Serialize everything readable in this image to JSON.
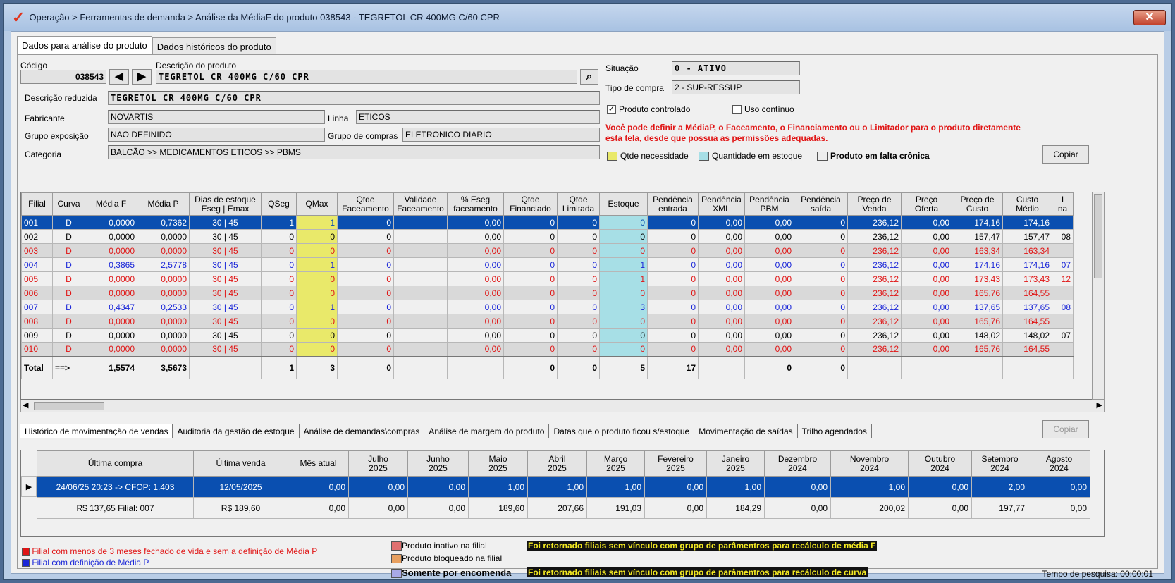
{
  "window": {
    "title": "Operação > Ferramentas de demanda > Análise da MédiaF do produto 038543 - TEGRETOL CR 400MG C/60 CPR",
    "close": "✕"
  },
  "tabs": [
    "Dados para análise do produto",
    "Dados históricos do produto"
  ],
  "form": {
    "codigo_label": "Código",
    "codigo": "038543",
    "descricao_label": "Descrição do produto",
    "descricao": "TEGRETOL CR 400MG C/60 CPR",
    "desc_reduzida_label": "Descrição reduzida",
    "desc_reduzida": "TEGRETOL CR 400MG C/60 CPR",
    "fabricante_label": "Fabricante",
    "fabricante": "NOVARTIS",
    "linha_label": "Linha",
    "linha": "ETICOS",
    "grupo_exposicao_label": "Grupo exposição",
    "grupo_exposicao": "NAO DEFINIDO",
    "grupo_compras_label": "Grupo de compras",
    "grupo_compras": "ELETRONICO DIARIO",
    "categoria_label": "Categoria",
    "categoria": "BALCÃO >> MEDICAMENTOS ETICOS >> PBMS",
    "situacao_label": "Situação",
    "situacao": "0 - ATIVO",
    "tipo_compra_label": "Tipo de compra",
    "tipo_compra": "2 - SUP-RESSUP",
    "produto_controlado": "Produto controlado",
    "uso_continuo": "Uso contínuo",
    "warning": "Você pode definir a MédiaP, o Faceamento, o Financiamento ou o Limitador para o produto diretamente\nesta tela, desde que possua as permissões adequadas.",
    "legend_qtde": "Qtde necessidade",
    "legend_estoque": "Quantidade em estoque",
    "legend_falta": "Produto em falta crônica",
    "copiar": "Copiar"
  },
  "grid": {
    "headers": [
      "Filial",
      "Curva",
      "Média F",
      "Média P",
      "Dias de estoque\nEseg | Emax",
      "QSeg",
      "QMax",
      "Qtde\nFaceamento",
      "Validade\nFaceamento",
      "% Eseg\nfaceamento",
      "Qtde\nFinanciado",
      "Qtde\nLimitada",
      "Estoque",
      "Pendência\nentrada",
      "Pendência\nXML",
      "Pendência\nPBM",
      "Pendência\nsaída",
      "Preço de\nVenda",
      "Preço\nOferta",
      "Preço de\nCusto",
      "Custo\nMédio",
      "I\nna"
    ],
    "rows": [
      {
        "cls": "sel",
        "cells": [
          "001",
          "D",
          "0,0000",
          "0,7362",
          "30   |   45",
          "1",
          "1",
          "0",
          "",
          "0,00",
          "0",
          "0",
          "0",
          "0",
          "0,00",
          "0,00",
          "0",
          "236,12",
          "0,00",
          "174,16",
          "174,16",
          ""
        ]
      },
      {
        "cls": "",
        "cells": [
          "002",
          "D",
          "0,0000",
          "0,0000",
          "30   |   45",
          "0",
          "0",
          "0",
          "",
          "0,00",
          "0",
          "0",
          "0",
          "0",
          "0,00",
          "0,00",
          "0",
          "236,12",
          "0,00",
          "157,47",
          "157,47",
          "08"
        ]
      },
      {
        "cls": "alt red",
        "cells": [
          "003",
          "D",
          "0,0000",
          "0,0000",
          "30   |   45",
          "0",
          "0",
          "0",
          "",
          "0,00",
          "0",
          "0",
          "0",
          "0",
          "0,00",
          "0,00",
          "0",
          "236,12",
          "0,00",
          "163,34",
          "163,34",
          ""
        ]
      },
      {
        "cls": "blue",
        "cells": [
          "004",
          "D",
          "0,3865",
          "2,5778",
          "30   |   45",
          "0",
          "1",
          "0",
          "",
          "0,00",
          "0",
          "0",
          "1",
          "0",
          "0,00",
          "0,00",
          "0",
          "236,12",
          "0,00",
          "174,16",
          "174,16",
          "07"
        ]
      },
      {
        "cls": "red",
        "cells": [
          "005",
          "D",
          "0,0000",
          "0,0000",
          "30   |   45",
          "0",
          "0",
          "0",
          "",
          "0,00",
          "0",
          "0",
          "1",
          "0",
          "0,00",
          "0,00",
          "0",
          "236,12",
          "0,00",
          "173,43",
          "173,43",
          "12"
        ]
      },
      {
        "cls": "alt red",
        "cells": [
          "006",
          "D",
          "0,0000",
          "0,0000",
          "30   |   45",
          "0",
          "0",
          "0",
          "",
          "0,00",
          "0",
          "0",
          "0",
          "0",
          "0,00",
          "0,00",
          "0",
          "236,12",
          "0,00",
          "165,76",
          "164,55",
          ""
        ]
      },
      {
        "cls": "blue",
        "cells": [
          "007",
          "D",
          "0,4347",
          "0,2533",
          "30   |   45",
          "0",
          "1",
          "0",
          "",
          "0,00",
          "0",
          "0",
          "3",
          "0",
          "0,00",
          "0,00",
          "0",
          "236,12",
          "0,00",
          "137,65",
          "137,65",
          "08"
        ]
      },
      {
        "cls": "alt red",
        "cells": [
          "008",
          "D",
          "0,0000",
          "0,0000",
          "30   |   45",
          "0",
          "0",
          "0",
          "",
          "0,00",
          "0",
          "0",
          "0",
          "0",
          "0,00",
          "0,00",
          "0",
          "236,12",
          "0,00",
          "165,76",
          "164,55",
          ""
        ]
      },
      {
        "cls": "",
        "cells": [
          "009",
          "D",
          "0,0000",
          "0,0000",
          "30   |   45",
          "0",
          "0",
          "0",
          "",
          "0,00",
          "0",
          "0",
          "0",
          "0",
          "0,00",
          "0,00",
          "0",
          "236,12",
          "0,00",
          "148,02",
          "148,02",
          "07"
        ]
      },
      {
        "cls": "alt red",
        "cells": [
          "010",
          "D",
          "0,0000",
          "0,0000",
          "30   |   45",
          "0",
          "0",
          "0",
          "",
          "0,00",
          "0",
          "0",
          "0",
          "0",
          "0,00",
          "0,00",
          "0",
          "236,12",
          "0,00",
          "165,76",
          "164,55",
          ""
        ]
      }
    ],
    "total": [
      "Total",
      "==>",
      "1,5574",
      "3,5673",
      "",
      "1",
      "3",
      "0",
      "",
      "",
      "0",
      "0",
      "5",
      "17",
      "",
      "0",
      "0",
      "",
      "",
      "",
      "",
      ""
    ]
  },
  "bottom_tabs": [
    "Histórico de movimentação de vendas",
    "Auditoria da gestão de estoque",
    "Análise de demandas\\compras",
    "Análise de margem do produto",
    "Datas que o produto ficou s/estoque",
    "Movimentação de saídas",
    "Trilho agendados"
  ],
  "copiar2": "Copiar",
  "history": {
    "headers": [
      "Última compra",
      "Última venda",
      "Mês atual",
      "Julho\n2025",
      "Junho\n2025",
      "Maio\n2025",
      "Abril\n2025",
      "Março\n2025",
      "Fevereiro\n2025",
      "Janeiro\n2025",
      "Dezembro\n2024",
      "Novembro\n2024",
      "Outubro\n2024",
      "Setembro\n2024",
      "Agosto\n2024"
    ],
    "rows": [
      [
        "24/06/25 20:23 -> CFOP: 1.403",
        "12/05/2025",
        "0,00",
        "0,00",
        "0,00",
        "1,00",
        "1,00",
        "1,00",
        "0,00",
        "1,00",
        "0,00",
        "1,00",
        "0,00",
        "2,00",
        "0,00"
      ],
      [
        "R$ 137,65 Filial: 007",
        "R$ 189,60",
        "0,00",
        "0,00",
        "0,00",
        "189,60",
        "207,66",
        "191,03",
        "0,00",
        "184,29",
        "0,00",
        "200,02",
        "0,00",
        "197,77",
        "0,00"
      ]
    ]
  },
  "legend": {
    "red": "Filial com menos de 3 meses fechado de vida e sem a definição de Média P",
    "blue": "Filial com definição de Média P",
    "inativo": "Produto inativo na filial",
    "bloqueado": "Produto bloqueado na filial",
    "encomenda": "Somente por encomenda",
    "msg1": "Foi retornado filiais sem vínculo com grupo de parâmentros para recálculo de média F",
    "msg2": "Foi retornado filiais sem vínculo com grupo de parâmentros para recálculo de curva",
    "tempo": "Tempo de pesquisa: 00:00:01"
  },
  "colors": {
    "selection": "#0a4fb0",
    "red": "#e01515",
    "blue": "#1a26d8",
    "yellow": "#e9e96a",
    "cyan": "#a7dfe6"
  }
}
